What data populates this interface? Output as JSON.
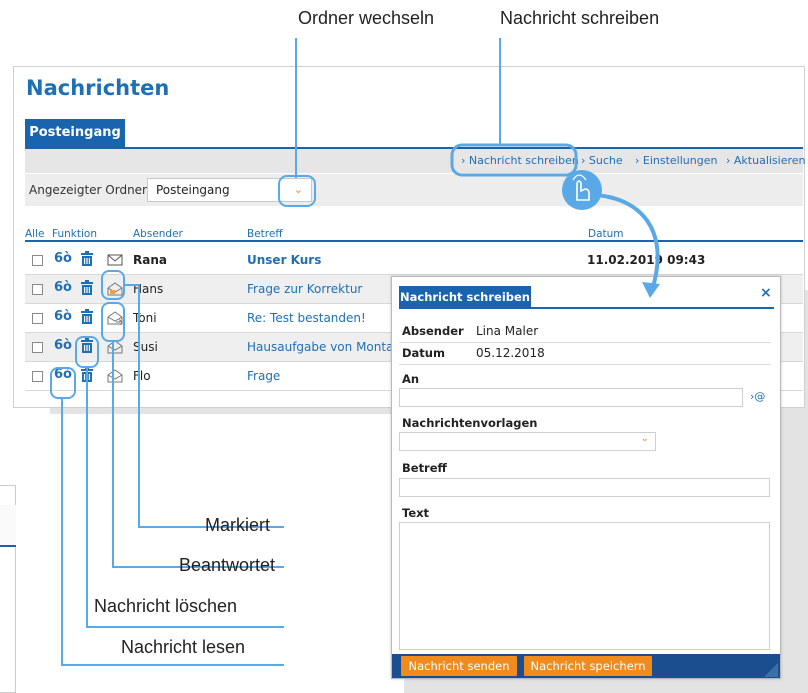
{
  "annotations": {
    "switch_folder": "Ordner wechseln",
    "compose_message": "Nachricht schreiben",
    "marked": "Markiert",
    "answered": "Beantwortet",
    "delete_message": "Nachricht löschen",
    "read_message": "Nachricht lesen"
  },
  "app": {
    "title": "Nachrichten",
    "tab": "Posteingang"
  },
  "toolbar": {
    "compose": "› Nachricht schreiben",
    "search": "› Suche",
    "settings": "› Einstellungen",
    "refresh": "› Aktualisieren"
  },
  "folder": {
    "label": "Angezeigter Ordner",
    "selected": "Posteingang"
  },
  "table": {
    "columns": {
      "all": "Alle",
      "function": "Funktion",
      "sender": "Absender",
      "subject": "Betreff",
      "date": "Datum"
    },
    "rows": [
      {
        "sender": "Rana",
        "subject": "Unser Kurs",
        "date": "11.02.2019 09:43",
        "unread": true
      },
      {
        "sender": "Hans",
        "subject": "Frage zur Korrektur",
        "date": "",
        "unread": false
      },
      {
        "sender": "Toni",
        "subject": "Re: Test bestanden!",
        "date": "",
        "unread": false
      },
      {
        "sender": "Susi",
        "subject": "Hausaufgabe von Monta",
        "date": "",
        "unread": false
      },
      {
        "sender": "Flo",
        "subject": "Frage",
        "date": "",
        "unread": false
      }
    ]
  },
  "dialog": {
    "tab": "Nachricht schreiben",
    "close": "×",
    "sender_label": "Absender",
    "sender_value": "Lina Maler",
    "date_label": "Datum",
    "date_value": "05.12.2018",
    "to_label": "An",
    "to_value": "",
    "to_picker": "›@",
    "templates_label": "Nachrichtenvorlagen",
    "templates_selected": "",
    "subject_label": "Betreff",
    "subject_value": "",
    "text_label": "Text",
    "text_value": "",
    "send_button": "Nachricht senden",
    "save_button": "Nachricht speichern"
  },
  "colors": {
    "accent_blue": "#1a64ad",
    "callout_blue": "#5aa9e6",
    "orange": "#f08c1e"
  }
}
